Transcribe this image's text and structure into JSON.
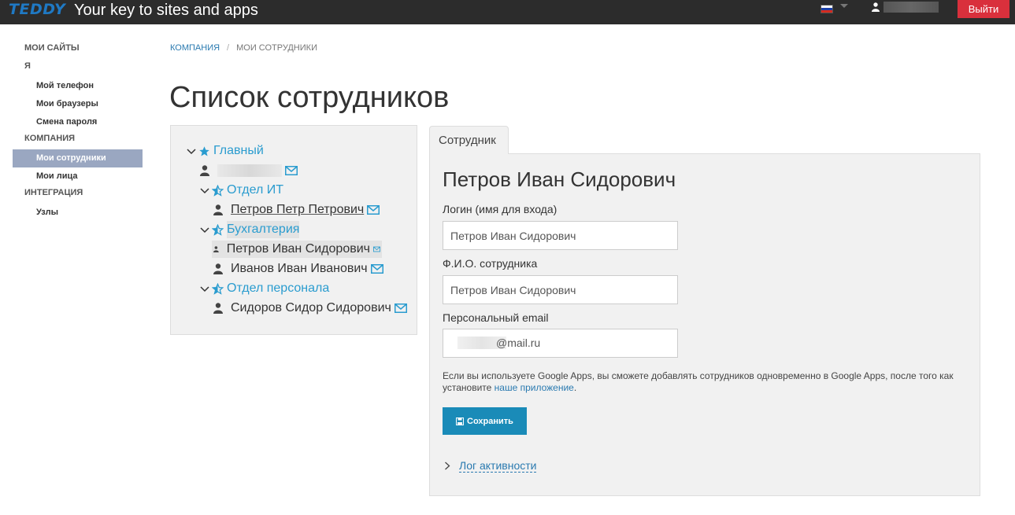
{
  "header": {
    "logo": "TEDDY",
    "tagline": "Your key to sites and apps",
    "logout_label": "Выйти",
    "flag_colors": [
      "#ffffff",
      "#1c3fa8",
      "#d52b1e"
    ]
  },
  "sidebar": {
    "sections": [
      {
        "label": "МОИ САЙТЫ",
        "items": []
      },
      {
        "label": "Я",
        "items": [
          "Мой телефон",
          "Мои браузеры",
          "Смена пароля"
        ]
      },
      {
        "label": "КОМПАНИЯ",
        "items": [
          "Мои сотрудники",
          "Мои лица"
        ]
      },
      {
        "label": "ИНТЕГРАЦИЯ",
        "items": [
          "Узлы"
        ]
      }
    ],
    "active_item": "Мои сотрудники"
  },
  "breadcrumb": {
    "items": [
      "КОМПАНИЯ",
      "МОИ СОТРУДНИКИ"
    ]
  },
  "page_title": "Список сотрудников",
  "tree": {
    "root": "Главный",
    "departments": [
      {
        "name": "Отдел ИТ",
        "employees": [
          "Петров Петр Петрович"
        ]
      },
      {
        "name": "Бухгалтерия",
        "employees": [
          "Петров Иван Сидорович",
          "Иванов Иван Иванович"
        ]
      },
      {
        "name": "Отдел персонала",
        "employees": [
          "Сидоров Сидор Сидорович"
        ]
      }
    ],
    "selected_employee": "Петров Иван Сидорович"
  },
  "employee_tab": {
    "tab_label": "Сотрудник",
    "name": "Петров Иван Сидорович",
    "login_label": "Логин (имя для входа)",
    "login_value": "Петров Иван Сидорович",
    "fio_label": "Ф.И.О. сотрудника",
    "fio_value": "Петров Иван Сидорович",
    "email_label": "Персональный email",
    "email_value": "@mail.ru",
    "hint_text": "Если вы используете Google Apps, вы сможете добавлять сотрудников одновременно в Google Apps, после того как установите ",
    "hint_link": "наше приложение",
    "hint_end": ".",
    "save_label": "Сохранить",
    "activity_label": "Лог активности"
  },
  "colors": {
    "accent": "#2a9ccf",
    "button": "#1a8bb8",
    "logout": "#d9303c",
    "active_sidebar": "#9aa7c1"
  }
}
